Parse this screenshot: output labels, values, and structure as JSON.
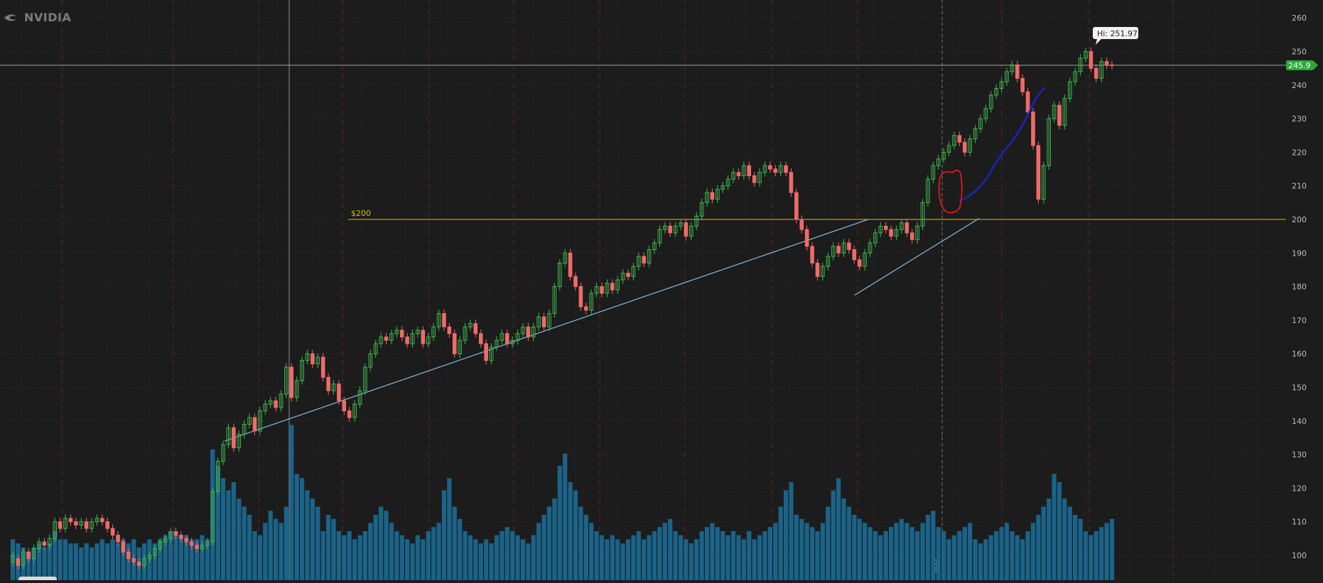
{
  "brand": {
    "name": "NVIDIA",
    "logo_icon": "nvidia-eye-icon"
  },
  "level_label": "$200",
  "high_label": "Hi: 251.97",
  "last_price": "245.9",
  "year_marker": "Year",
  "colors": {
    "background": "#1c1c1c",
    "up": "#3fb84f",
    "down": "#f06a6a",
    "volume": "#1c6b96",
    "level_line": "#d4c200",
    "trendline": "#7fb0d6",
    "annotation_blue": "#1727c8",
    "annotation_red": "#e01919",
    "price_tag": "#2ea83a"
  },
  "chart_data": {
    "type": "candlestick",
    "title": "",
    "ylabel": "",
    "ylim": [
      95,
      263
    ],
    "y_ticks": [
      100,
      110,
      120,
      130,
      140,
      150,
      160,
      170,
      180,
      190,
      200,
      210,
      220,
      230,
      240,
      250,
      260
    ],
    "grid": true,
    "horizontal_levels": [
      200,
      245.9
    ],
    "annotations": [
      "$200",
      "Hi: 251.97",
      "245.9"
    ],
    "candles": [
      [
        98,
        100
      ],
      [
        99,
        97
      ],
      [
        97,
        101
      ],
      [
        101,
        99
      ],
      [
        99,
        102
      ],
      [
        102,
        104
      ],
      [
        104,
        103
      ],
      [
        103,
        105
      ],
      [
        105,
        110
      ],
      [
        110,
        108
      ],
      [
        108,
        111
      ],
      [
        111,
        110
      ],
      [
        110,
        109
      ],
      [
        109,
        110
      ],
      [
        110,
        108
      ],
      [
        108,
        110
      ],
      [
        110,
        111
      ],
      [
        111,
        110
      ],
      [
        110,
        108
      ],
      [
        108,
        106
      ],
      [
        106,
        104
      ],
      [
        104,
        101
      ],
      [
        101,
        99
      ],
      [
        99,
        98
      ],
      [
        98,
        97
      ],
      [
        97,
        99
      ],
      [
        99,
        100
      ],
      [
        100,
        102
      ],
      [
        102,
        104
      ],
      [
        104,
        105
      ],
      [
        105,
        107
      ],
      [
        107,
        106
      ],
      [
        106,
        105
      ],
      [
        105,
        104
      ],
      [
        104,
        103
      ],
      [
        103,
        102
      ],
      [
        102,
        103
      ],
      [
        103,
        104
      ],
      [
        104,
        119
      ],
      [
        119,
        128
      ],
      [
        128,
        133
      ],
      [
        133,
        138
      ],
      [
        138,
        132
      ],
      [
        132,
        136
      ],
      [
        136,
        139
      ],
      [
        139,
        141
      ],
      [
        141,
        137
      ],
      [
        137,
        143
      ],
      [
        143,
        145
      ],
      [
        145,
        146
      ],
      [
        146,
        144
      ],
      [
        144,
        148
      ],
      [
        148,
        156
      ],
      [
        156,
        147
      ],
      [
        147,
        152
      ],
      [
        152,
        158
      ],
      [
        158,
        160
      ],
      [
        160,
        157
      ],
      [
        157,
        159
      ],
      [
        159,
        153
      ],
      [
        153,
        149
      ],
      [
        149,
        151
      ],
      [
        151,
        146
      ],
      [
        146,
        143
      ],
      [
        143,
        141
      ],
      [
        141,
        145
      ],
      [
        145,
        149
      ],
      [
        149,
        156
      ],
      [
        156,
        160
      ],
      [
        160,
        163
      ],
      [
        163,
        165
      ],
      [
        165,
        164
      ],
      [
        164,
        166
      ],
      [
        166,
        167
      ],
      [
        167,
        165
      ],
      [
        165,
        163
      ],
      [
        163,
        166
      ],
      [
        166,
        167
      ],
      [
        167,
        163
      ],
      [
        163,
        165
      ],
      [
        165,
        168
      ],
      [
        168,
        172
      ],
      [
        172,
        168
      ],
      [
        168,
        166
      ],
      [
        166,
        160
      ],
      [
        160,
        164
      ],
      [
        164,
        168
      ],
      [
        168,
        169
      ],
      [
        169,
        166
      ],
      [
        166,
        163
      ],
      [
        163,
        158
      ],
      [
        158,
        162
      ],
      [
        162,
        164
      ],
      [
        164,
        166
      ],
      [
        166,
        163
      ],
      [
        163,
        164
      ],
      [
        164,
        166
      ],
      [
        166,
        168
      ],
      [
        168,
        165
      ],
      [
        165,
        168
      ],
      [
        168,
        171
      ],
      [
        171,
        168
      ],
      [
        168,
        172
      ],
      [
        172,
        180
      ],
      [
        180,
        187
      ],
      [
        187,
        190
      ],
      [
        190,
        183
      ],
      [
        183,
        180
      ],
      [
        180,
        174
      ],
      [
        174,
        173
      ],
      [
        173,
        178
      ],
      [
        178,
        180
      ],
      [
        180,
        178
      ],
      [
        178,
        181
      ],
      [
        181,
        179
      ],
      [
        179,
        182
      ],
      [
        182,
        184
      ],
      [
        184,
        183
      ],
      [
        183,
        186
      ],
      [
        186,
        189
      ],
      [
        189,
        187
      ],
      [
        187,
        191
      ],
      [
        191,
        193
      ],
      [
        193,
        197
      ],
      [
        197,
        198
      ],
      [
        198,
        196
      ],
      [
        196,
        198
      ],
      [
        198,
        199
      ],
      [
        199,
        195
      ],
      [
        195,
        198
      ],
      [
        198,
        201
      ],
      [
        201,
        205
      ],
      [
        205,
        208
      ],
      [
        208,
        206
      ],
      [
        206,
        209
      ],
      [
        209,
        210
      ],
      [
        210,
        212
      ],
      [
        212,
        214
      ],
      [
        214,
        213
      ],
      [
        213,
        216
      ],
      [
        216,
        213
      ],
      [
        213,
        211
      ],
      [
        211,
        214
      ],
      [
        214,
        216
      ],
      [
        216,
        215
      ],
      [
        215,
        214
      ],
      [
        214,
        216
      ],
      [
        216,
        214
      ],
      [
        214,
        208
      ],
      [
        208,
        200
      ],
      [
        200,
        197
      ],
      [
        197,
        192
      ],
      [
        192,
        187
      ],
      [
        187,
        183
      ],
      [
        183,
        186
      ],
      [
        186,
        189
      ],
      [
        189,
        192
      ],
      [
        192,
        190
      ],
      [
        190,
        193
      ],
      [
        193,
        191
      ],
      [
        191,
        188
      ],
      [
        188,
        186
      ],
      [
        186,
        190
      ],
      [
        190,
        193
      ],
      [
        193,
        196
      ],
      [
        196,
        198
      ],
      [
        198,
        197
      ],
      [
        197,
        195
      ],
      [
        195,
        197
      ],
      [
        197,
        199
      ],
      [
        199,
        196
      ],
      [
        196,
        194
      ],
      [
        194,
        198
      ],
      [
        198,
        205
      ],
      [
        205,
        212
      ],
      [
        212,
        216
      ],
      [
        216,
        218
      ],
      [
        218,
        220
      ],
      [
        220,
        222
      ],
      [
        222,
        225
      ],
      [
        225,
        223
      ],
      [
        223,
        220
      ],
      [
        220,
        224
      ],
      [
        224,
        227
      ],
      [
        227,
        230
      ],
      [
        230,
        233
      ],
      [
        233,
        237
      ],
      [
        237,
        239
      ],
      [
        239,
        241
      ],
      [
        241,
        244
      ],
      [
        244,
        246
      ],
      [
        246,
        242
      ],
      [
        242,
        238
      ],
      [
        238,
        232
      ],
      [
        232,
        222
      ],
      [
        222,
        206
      ],
      [
        206,
        216
      ],
      [
        216,
        230
      ],
      [
        230,
        234
      ],
      [
        234,
        228
      ],
      [
        228,
        236
      ],
      [
        236,
        241
      ],
      [
        241,
        244
      ],
      [
        244,
        248
      ],
      [
        248,
        250
      ],
      [
        250,
        245
      ],
      [
        245,
        242
      ],
      [
        242,
        247
      ],
      [
        247,
        246
      ],
      [
        246,
        245.9
      ]
    ],
    "volume": [
      10,
      9,
      8,
      7,
      8,
      9,
      8,
      9,
      12,
      10,
      10,
      9,
      9,
      8,
      9,
      8,
      9,
      10,
      9,
      10,
      9,
      10,
      9,
      10,
      8,
      9,
      10,
      9,
      10,
      11,
      12,
      12,
      11,
      11,
      10,
      10,
      11,
      10,
      32,
      28,
      25,
      22,
      24,
      20,
      18,
      16,
      12,
      11,
      14,
      17,
      15,
      14,
      18,
      38,
      26,
      25,
      22,
      20,
      18,
      12,
      16,
      15,
      12,
      11,
      12,
      10,
      11,
      12,
      14,
      16,
      18,
      17,
      14,
      12,
      11,
      10,
      9,
      11,
      10,
      12,
      13,
      14,
      22,
      25,
      18,
      15,
      12,
      11,
      10,
      9,
      10,
      9,
      11,
      12,
      13,
      12,
      11,
      10,
      9,
      11,
      14,
      16,
      18,
      20,
      28,
      31,
      24,
      22,
      18,
      16,
      14,
      12,
      11,
      10,
      11,
      10,
      9,
      10,
      11,
      12,
      10,
      11,
      12,
      13,
      14,
      15,
      12,
      11,
      10,
      9,
      10,
      12,
      13,
      14,
      13,
      12,
      11,
      12,
      11,
      10,
      12,
      10,
      11,
      12,
      13,
      14,
      18,
      22,
      24,
      16,
      15,
      14,
      13,
      12,
      14,
      18,
      22,
      25,
      20,
      18,
      16,
      15,
      14,
      13,
      12,
      11,
      12,
      13,
      14,
      15,
      14,
      13,
      12,
      14,
      16,
      17,
      13,
      12,
      10,
      11,
      12,
      13,
      14,
      10,
      9,
      10,
      11,
      12,
      13,
      14,
      12,
      11,
      10,
      12,
      14,
      16,
      18,
      20,
      26,
      24,
      20,
      18,
      16,
      15,
      12,
      11,
      12,
      13,
      14,
      15
    ]
  }
}
